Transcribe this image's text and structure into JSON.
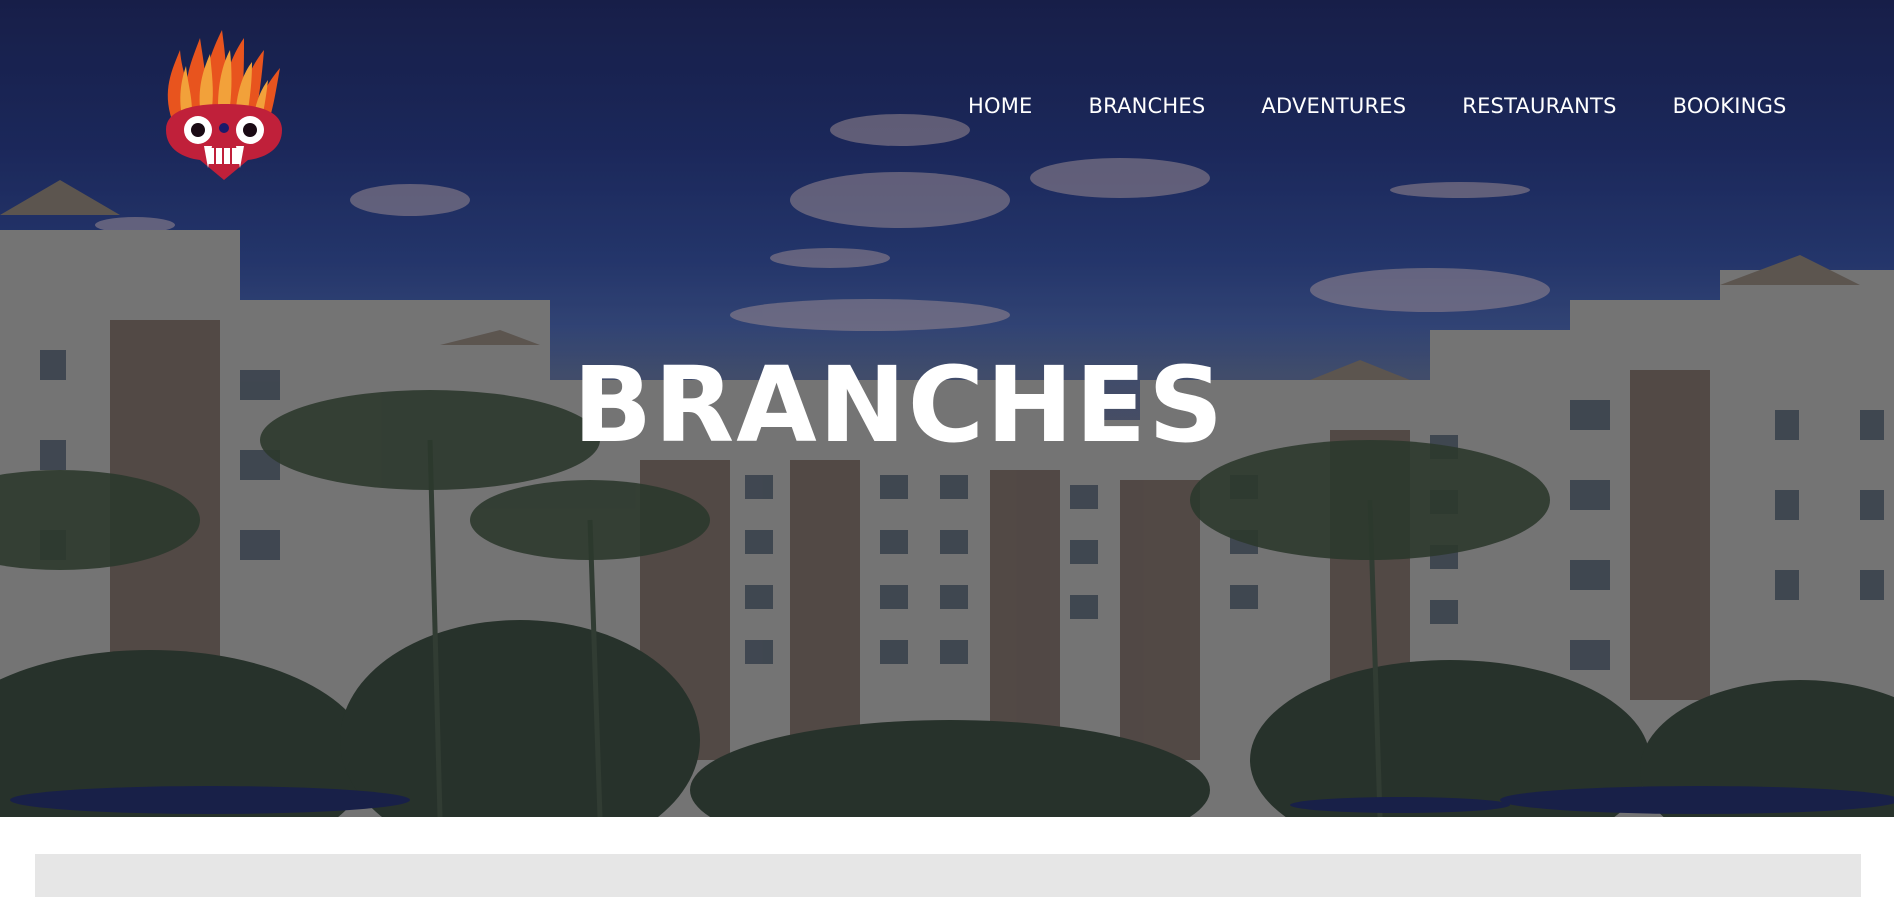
{
  "nav": {
    "items": [
      {
        "label": "HOME"
      },
      {
        "label": "BRANCHES"
      },
      {
        "label": "ADVENTURES"
      },
      {
        "label": "RESTAURANTS"
      },
      {
        "label": "BOOKINGS"
      }
    ]
  },
  "hero": {
    "title": "BRANCHES"
  },
  "logo": {
    "icon": "fire-demon-mask-logo",
    "colors": [
      "#e8541e",
      "#f2a13a",
      "#c0203a",
      "#ffffff"
    ]
  },
  "colors": {
    "sky_top": "#1a2250",
    "section_bg": "#e6e6e6",
    "text": "#ffffff"
  }
}
